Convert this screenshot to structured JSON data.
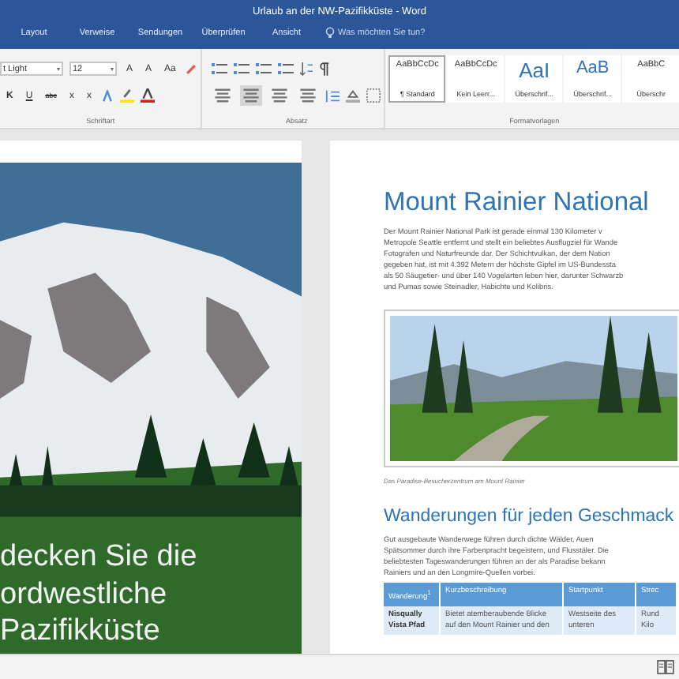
{
  "window": {
    "title": "Urlaub an der NW-Pazifikküste - Word"
  },
  "tabs": [
    {
      "label": "Layout",
      "selected": false
    },
    {
      "label": "Verweise",
      "selected": false
    },
    {
      "label": "Sendungen",
      "selected": false
    },
    {
      "label": "Überprüfen",
      "selected": false
    },
    {
      "label": "Ansicht",
      "selected": false
    }
  ],
  "search": {
    "placeholder": "Was möchten Sie tun?"
  },
  "font_group": {
    "font": "t Light",
    "size": "12",
    "row1_buttons": [
      "A",
      "A",
      "Aa"
    ],
    "row2_buttons": [
      "K",
      "U",
      "abc",
      "x",
      "x"
    ],
    "label": "Schriftart"
  },
  "paragraph_group": {
    "label": "Absatz",
    "align": [
      {
        "selected": false
      },
      {
        "selected": true
      },
      {
        "selected": false
      },
      {
        "selected": false
      }
    ]
  },
  "styles": {
    "label": "Formatvorlagen",
    "items": [
      {
        "preview": "AaBbCcDc",
        "label": "¶ Standard",
        "selected": true,
        "kind": "body"
      },
      {
        "preview": "AaBbCcDc",
        "label": "Kein Leerr...",
        "selected": false,
        "kind": "body"
      },
      {
        "preview": "AaI",
        "label": "Überschrif...",
        "selected": false,
        "kind": "heading1"
      },
      {
        "preview": "AaB",
        "label": "Überschrif...",
        "selected": false,
        "kind": "heading2"
      },
      {
        "preview": "AaBbC",
        "label": "Überschr",
        "selected": false,
        "kind": "body"
      }
    ]
  },
  "cover": {
    "title_lines": [
      "decken Sie die",
      "ordwestliche",
      "Pazifikküste"
    ]
  },
  "page": {
    "heading": "Mount Rainier National",
    "intro_lines": [
      "Der Mount Rainier National Park ist gerade einmal 130 Kilometer v",
      "Metropole Seattle entfernt und stellt ein beliebtes Ausflugziel für Wande",
      "Fotografen und Naturfreunde dar. Der Schichtvulkan, der dem Nation",
      "gegeben hat, ist mit 4.392 Metern der höchste Gipfel im US-Bundessta",
      "als 50 Säugetier- und über 140 Vogelarten leben hier, darunter Schwarzb",
      "und Pumas sowie Steinadler, Habichte und Kolibris."
    ],
    "caption": "Das Paradise-Besucherzentrum am Mount Rainier",
    "heading2": "Wanderungen für jeden Geschmack",
    "hike_lines": [
      "Gut ausgebaute Wanderwege führen durch dichte Wälder, Auen",
      "Spätsommer durch ihre Farbenpracht begeistern, und Flusstäler. Die",
      "beliebtesten Tageswanderungen führen an der als Paradise bekann",
      "Rainiers und an den Longmire-Quellen vorbei."
    ],
    "table": {
      "columns": [
        "Wanderung$^{1}$",
        "Kurzbeschreibung",
        "Startpunkt",
        "Strec"
      ],
      "rows": [
        [
          "Nisqually Vista Pfad",
          "Bietet atemberaubende Blicke auf den Mount Rainier und den",
          "Westseite des unteren",
          "Rund Kilo"
        ]
      ]
    }
  }
}
